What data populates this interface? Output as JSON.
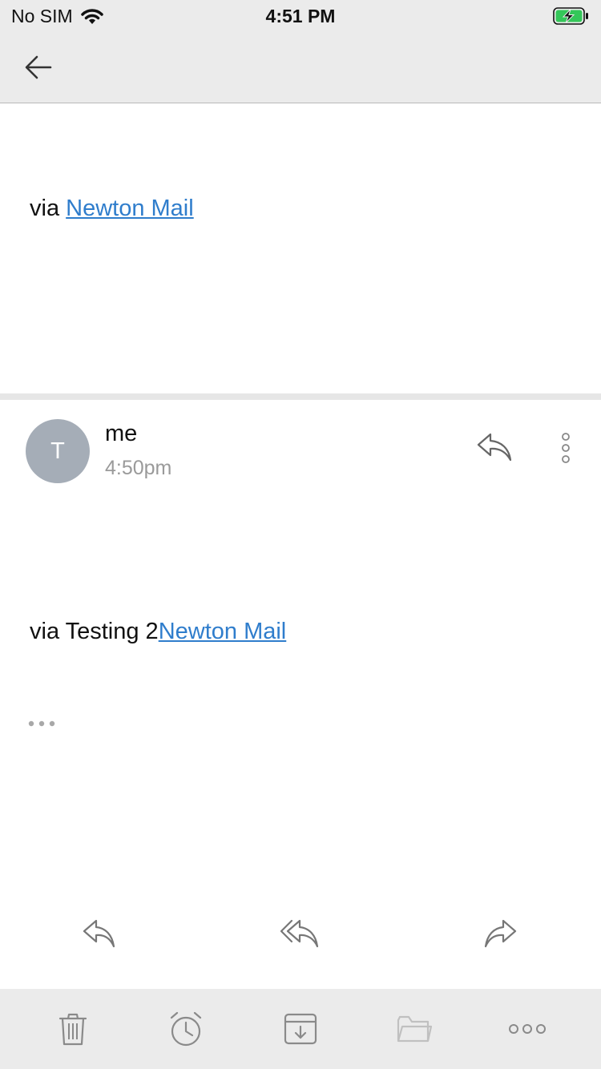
{
  "status_bar": {
    "carrier": "No SIM",
    "time": "4:51 PM",
    "battery_color": "#34c759"
  },
  "nav": {
    "back_icon": "back-arrow-icon"
  },
  "messages": [
    {
      "body_prefix": "via ",
      "link_text": "Newton Mail"
    },
    {
      "avatar_initial": "T",
      "sender": "me",
      "time": "4:50pm",
      "body_prefix": "via Testing 2",
      "link_text": "Newton Mail"
    }
  ],
  "actions": [
    "reply-icon",
    "reply-all-icon",
    "forward-icon"
  ],
  "toolbar": [
    "trash-icon",
    "snooze-alarm-icon",
    "archive-icon",
    "folder-icon",
    "more-horizontal-icon"
  ],
  "colors": {
    "link": "#2f7dcc",
    "avatar_bg": "#a5adb7",
    "bar_bg": "#ebebeb"
  }
}
